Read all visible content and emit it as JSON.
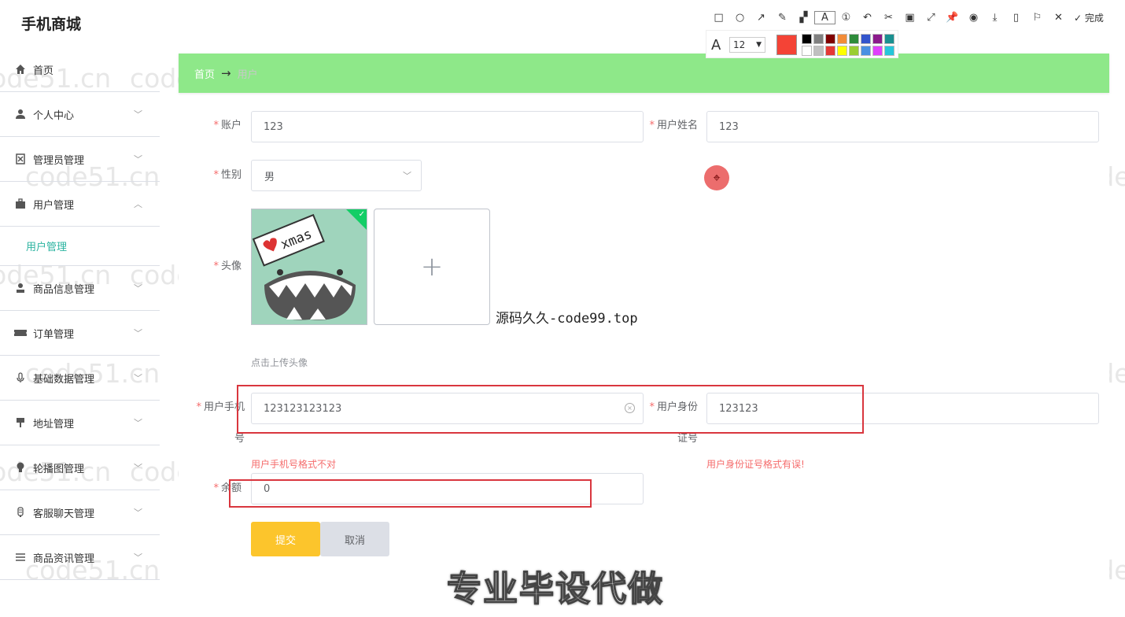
{
  "app": {
    "title": "手机商城"
  },
  "sidebar": {
    "items": [
      {
        "label": "首页",
        "icon": "home-icon"
      },
      {
        "label": "个人中心",
        "icon": "user-icon"
      },
      {
        "label": "管理员管理",
        "icon": "admin-icon"
      },
      {
        "label": "用户管理",
        "icon": "briefcase-icon",
        "expanded": true,
        "children": [
          {
            "label": "用户管理"
          }
        ]
      },
      {
        "label": "商品信息管理",
        "icon": "person-icon"
      },
      {
        "label": "订单管理",
        "icon": "ticket-icon"
      },
      {
        "label": "基础数据管理",
        "icon": "microphone-icon"
      },
      {
        "label": "地址管理",
        "icon": "pin-icon"
      },
      {
        "label": "轮播图管理",
        "icon": "bulb-icon"
      },
      {
        "label": "客服聊天管理",
        "icon": "chat-icon"
      },
      {
        "label": "商品资讯管理",
        "icon": "list-icon"
      }
    ]
  },
  "breadcrumb": {
    "home": "首页",
    "separator": "→",
    "current": "用户"
  },
  "form": {
    "account": {
      "label": "账户",
      "value": "123"
    },
    "username": {
      "label": "用户姓名",
      "value": "123"
    },
    "gender": {
      "label": "性别",
      "value": "男"
    },
    "avatar": {
      "label": "头像",
      "tip": "点击上传头像",
      "image_text": "xmas"
    },
    "phone": {
      "label_line1": "用户手机",
      "label_line2": "号",
      "value": "123123123123",
      "error": "用户手机号格式不对"
    },
    "id_card": {
      "label_line1": "用户身份",
      "label_line2": "证号",
      "value": "123123",
      "error": "用户身份证号格式有误!"
    },
    "balance": {
      "label": "余额",
      "value": "0"
    },
    "submit_label": "提交",
    "cancel_label": "取消"
  },
  "overlay": {
    "text": "源码久久-code99.top",
    "caption": "专业毕设代做",
    "watermark": "code51.cn"
  },
  "screenshot_tool": {
    "font_size": "12",
    "done_label": "完成",
    "selected_color": "#f44336",
    "colors": [
      "#000000",
      "#808080",
      "#800000",
      "#f28c38",
      "#2e8b3a",
      "#3355cc",
      "#8b1a8b",
      "#1a9090",
      "#ffffff",
      "#c0c0c0",
      "#e53935",
      "#ffff00",
      "#9acd32",
      "#4a90e2",
      "#e040fb",
      "#26c6da"
    ]
  }
}
